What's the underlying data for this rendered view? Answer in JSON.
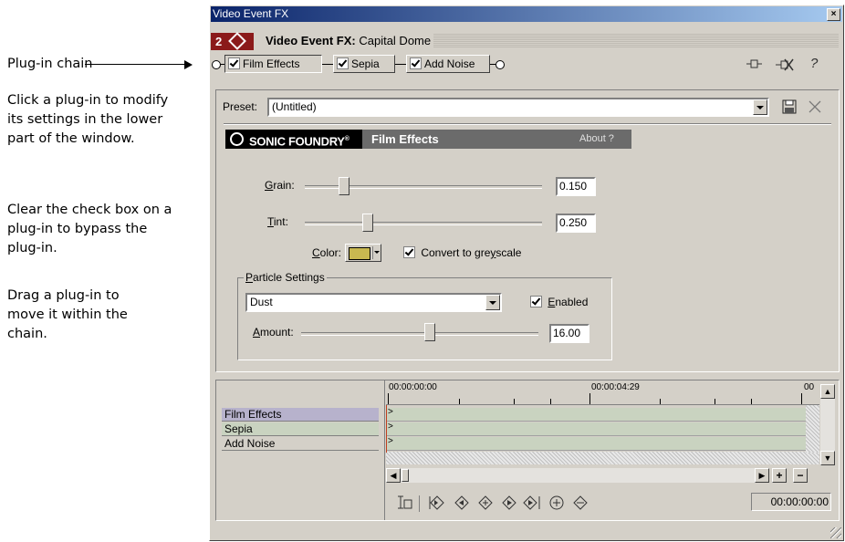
{
  "annotations": {
    "chain_label": "Plug-in chain",
    "p1": "Click a plug-in to modify its settings in the lower part of the window.",
    "p2": "Clear the check box on a plug-in to bypass the plug-in.",
    "p3": "Drag a plug-in to move it within the chain."
  },
  "window": {
    "title": "Video Event FX",
    "close_glyph": "×"
  },
  "header": {
    "badge_number": "2",
    "title_bold": "Video Event FX:",
    "title_rest": " Capital Dome"
  },
  "chain": {
    "plugins": [
      {
        "label": "Film Effects",
        "checked": true
      },
      {
        "label": "Sepia",
        "checked": true
      },
      {
        "label": "Add Noise",
        "checked": true
      }
    ],
    "help_glyph": "?"
  },
  "preset": {
    "label_pre": "Preset:",
    "value": "(Untitled)"
  },
  "banner": {
    "brand": "SONIC FOUNDRY",
    "reg": "®",
    "plugin_name": "Film Effects",
    "about": "About  ?"
  },
  "settings": {
    "grain": {
      "label_u": "G",
      "label_rest": "rain:",
      "value": "0.150"
    },
    "tint": {
      "label_u": "T",
      "label_rest": "int:",
      "value": "0.250"
    },
    "color": {
      "label_u": "C",
      "label_rest": "olor:",
      "swatch": "#c8b850"
    },
    "greyscale": {
      "label_a": "Convert to gre",
      "label_u": "y",
      "label_b": "scale",
      "checked": true
    },
    "particle": {
      "title_u": "P",
      "title_rest": "article Settings",
      "type": "Dust",
      "enabled": {
        "label_u": "E",
        "label_rest": "nabled",
        "checked": true
      },
      "amount": {
        "label_u": "A",
        "label_rest": "mount:",
        "value": "16.00"
      }
    }
  },
  "timeline": {
    "tracks": [
      "Film Effects",
      "Sepia",
      "Add Noise"
    ],
    "ruler": [
      "00:00:00:00",
      "00:00:04:29",
      "00"
    ],
    "timecode": "00:00:00:00",
    "plus": "+",
    "minus": "−"
  }
}
